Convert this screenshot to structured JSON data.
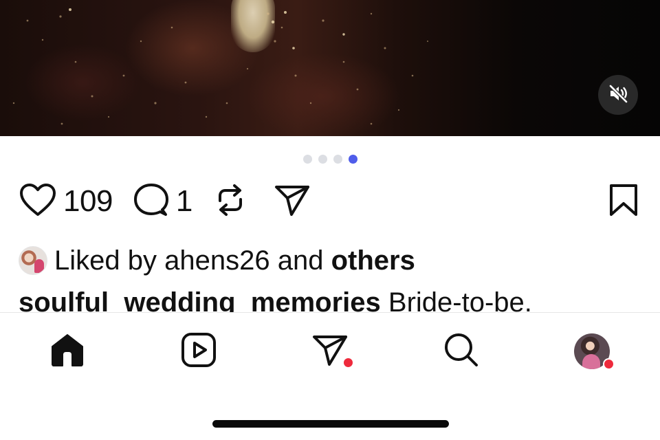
{
  "post": {
    "pager": {
      "total": 4,
      "active_index": 3
    },
    "actions": {
      "like_count": "109",
      "comment_count": "1",
      "like_icon": "heart-icon",
      "comment_icon": "comment-bubble-icon",
      "repost_icon": "repost-icon",
      "share_icon": "send-icon",
      "bookmark_icon": "bookmark-icon"
    },
    "liked_by": {
      "prefix": "Liked by",
      "user": "ahens26",
      "connector": "and",
      "others": "others"
    },
    "caption": {
      "tags": [
        "soulful",
        "wedding",
        "memories"
      ],
      "text": "Bride-to-be."
    },
    "media": {
      "mute_icon": "speaker-muted-icon"
    }
  },
  "nav": {
    "items": [
      {
        "name": "home",
        "icon": "home-icon",
        "active": true
      },
      {
        "name": "reels",
        "icon": "reels-icon",
        "active": false
      },
      {
        "name": "direct",
        "icon": "send-icon",
        "active": false,
        "notification": true
      },
      {
        "name": "search",
        "icon": "search-icon",
        "active": false
      },
      {
        "name": "profile",
        "icon": "avatar",
        "active": false,
        "notification": true
      }
    ]
  },
  "colors": {
    "accent": "#4f5dea",
    "notification": "#ee2a3c",
    "text": "#111111",
    "dot_inactive": "#dcdee3"
  }
}
